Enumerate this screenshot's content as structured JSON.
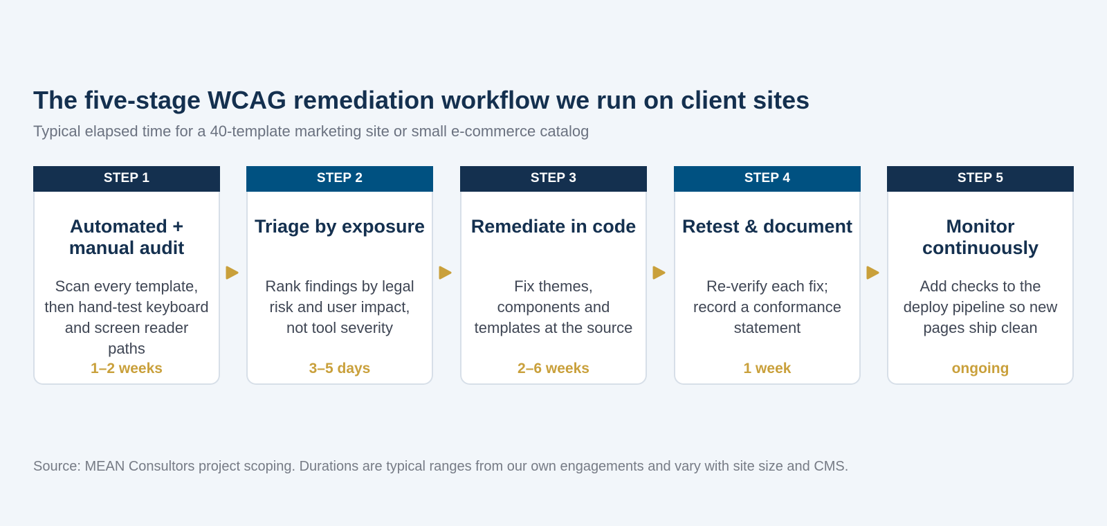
{
  "header": {
    "title": "The five-stage WCAG remediation workflow we run on client sites",
    "subtitle": "Typical elapsed time for a 40-template marketing site or small e-commerce catalog"
  },
  "steps": [
    {
      "label": "STEP 1",
      "title": "Automated + manual audit",
      "description": "Scan every template, then hand-test keyboard and screen reader paths",
      "duration": "1–2 weeks",
      "header_color": "#14304f"
    },
    {
      "label": "STEP 2",
      "title": "Triage by exposure",
      "description": "Rank findings by legal risk and user impact, not tool severity",
      "duration": "3–5 days",
      "header_color": "#005181"
    },
    {
      "label": "STEP 3",
      "title": "Remediate in code",
      "description": "Fix themes, components and templates at the source",
      "duration": "2–6 weeks",
      "header_color": "#14304f"
    },
    {
      "label": "STEP 4",
      "title": "Retest & document",
      "description": "Re-verify each fix; record a conformance statement",
      "duration": "1 week",
      "header_color": "#005181"
    },
    {
      "label": "STEP 5",
      "title": "Monitor continuously",
      "description": "Add checks to the deploy pipeline so new pages ship clean",
      "duration": "ongoing",
      "header_color": "#14304f"
    }
  ],
  "footer": {
    "source": "Source: MEAN Consultors project scoping. Durations are typical ranges from our own engagements and vary with site size and CMS."
  },
  "colors": {
    "background": "#f2f6fa",
    "navy": "#14304f",
    "blue": "#005181",
    "accent_gold": "#c9a03b"
  }
}
